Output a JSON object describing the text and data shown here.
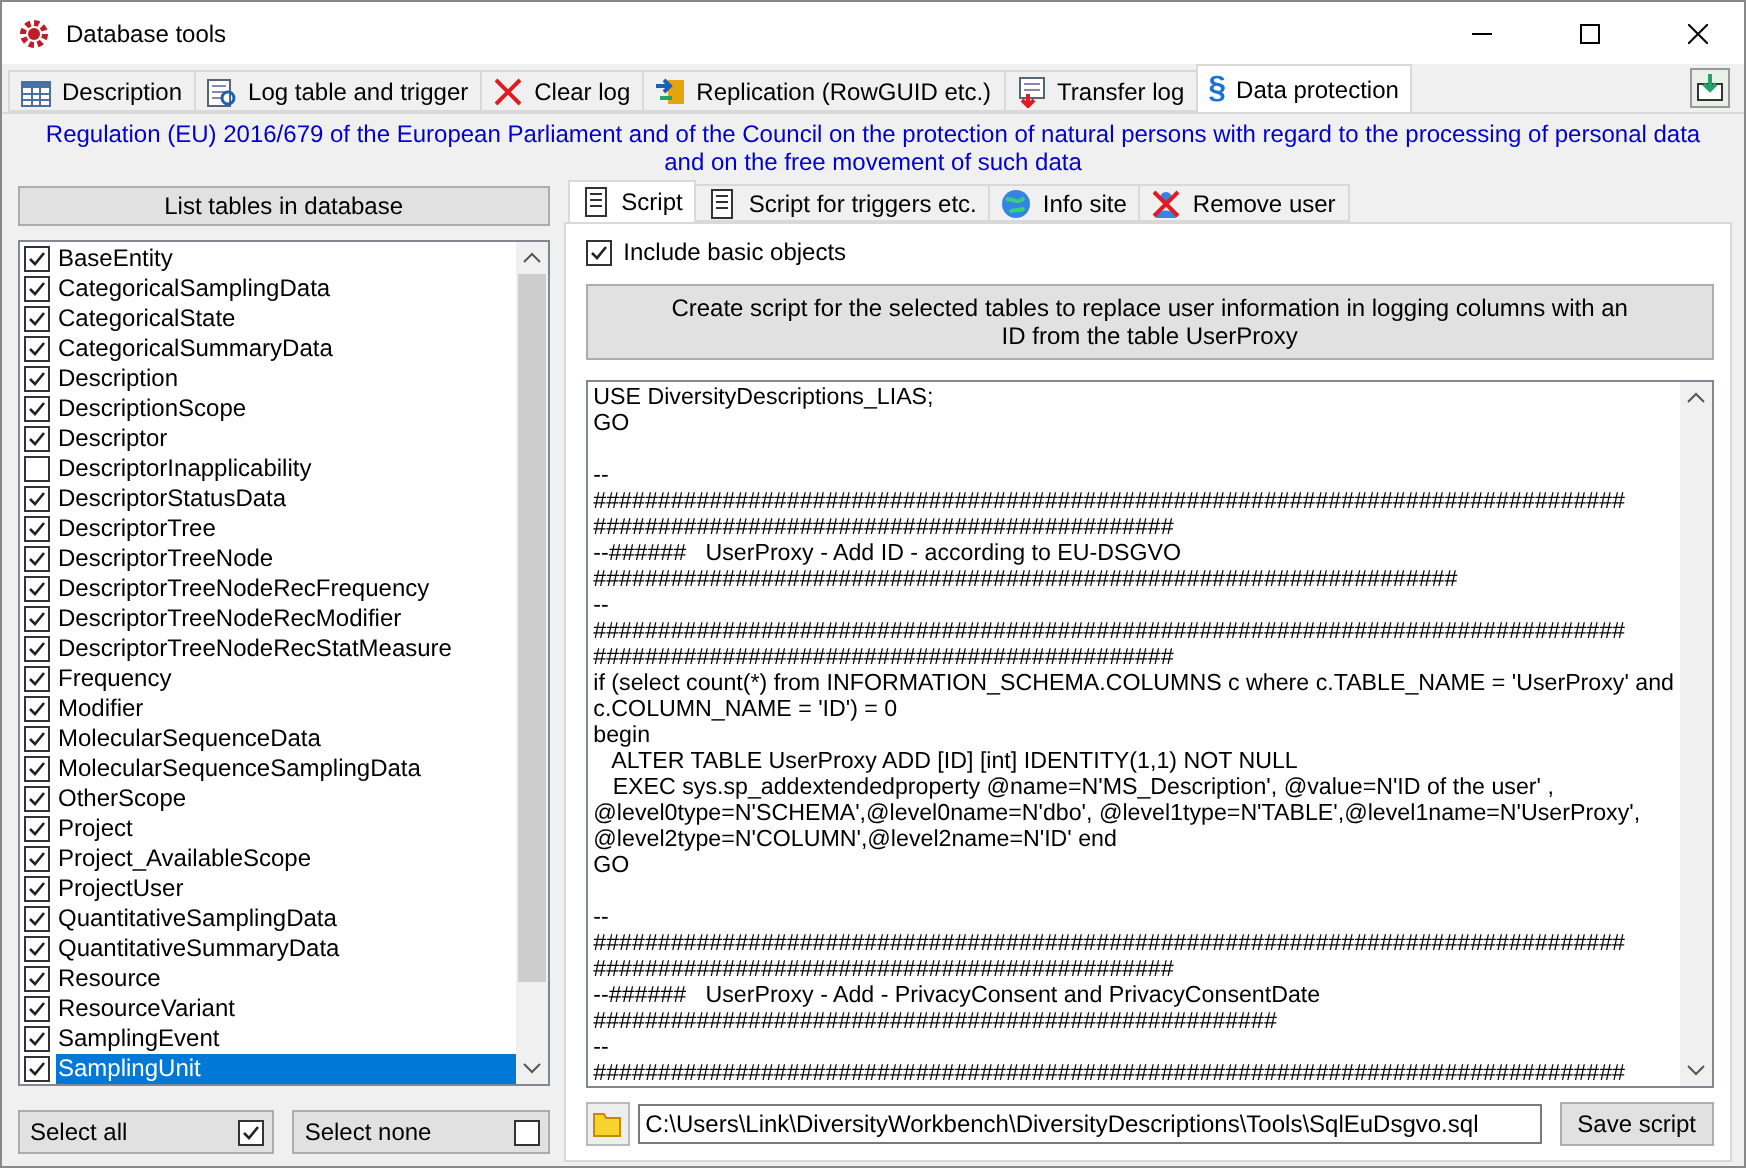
{
  "window": {
    "title": "Database tools"
  },
  "tabs": [
    {
      "label": "Description",
      "selected": false
    },
    {
      "label": "Log table and trigger",
      "selected": false
    },
    {
      "label": "Clear log",
      "selected": false
    },
    {
      "label": "Replication (RowGUID etc.)",
      "selected": false
    },
    {
      "label": "Transfer log",
      "selected": false
    },
    {
      "label": "Data protection",
      "symbol": "§",
      "selected": true
    }
  ],
  "regulation": "Regulation (EU) 2016/679 of the European Parliament and of the Council on the protection of natural persons with regard to the processing of personal data and on the free movement of such data",
  "left_panel": {
    "list_button": "List tables in database",
    "tables": [
      {
        "name": "BaseEntity",
        "checked": true,
        "selected": false
      },
      {
        "name": "CategoricalSamplingData",
        "checked": true,
        "selected": false
      },
      {
        "name": "CategoricalState",
        "checked": true,
        "selected": false
      },
      {
        "name": "CategoricalSummaryData",
        "checked": true,
        "selected": false
      },
      {
        "name": "Description",
        "checked": true,
        "selected": false
      },
      {
        "name": "DescriptionScope",
        "checked": true,
        "selected": false
      },
      {
        "name": "Descriptor",
        "checked": true,
        "selected": false
      },
      {
        "name": "DescriptorInapplicability",
        "checked": false,
        "selected": false
      },
      {
        "name": "DescriptorStatusData",
        "checked": true,
        "selected": false
      },
      {
        "name": "DescriptorTree",
        "checked": true,
        "selected": false
      },
      {
        "name": "DescriptorTreeNode",
        "checked": true,
        "selected": false
      },
      {
        "name": "DescriptorTreeNodeRecFrequency",
        "checked": true,
        "selected": false
      },
      {
        "name": "DescriptorTreeNodeRecModifier",
        "checked": true,
        "selected": false
      },
      {
        "name": "DescriptorTreeNodeRecStatMeasure",
        "checked": true,
        "selected": false
      },
      {
        "name": "Frequency",
        "checked": true,
        "selected": false
      },
      {
        "name": "Modifier",
        "checked": true,
        "selected": false
      },
      {
        "name": "MolecularSequenceData",
        "checked": true,
        "selected": false
      },
      {
        "name": "MolecularSequenceSamplingData",
        "checked": true,
        "selected": false
      },
      {
        "name": "OtherScope",
        "checked": true,
        "selected": false
      },
      {
        "name": "Project",
        "checked": true,
        "selected": false
      },
      {
        "name": "Project_AvailableScope",
        "checked": true,
        "selected": false
      },
      {
        "name": "ProjectUser",
        "checked": true,
        "selected": false
      },
      {
        "name": "QuantitativeSamplingData",
        "checked": true,
        "selected": false
      },
      {
        "name": "QuantitativeSummaryData",
        "checked": true,
        "selected": false
      },
      {
        "name": "Resource",
        "checked": true,
        "selected": false
      },
      {
        "name": "ResourceVariant",
        "checked": true,
        "selected": false
      },
      {
        "name": "SamplingEvent",
        "checked": true,
        "selected": false
      },
      {
        "name": "SamplingUnit",
        "checked": true,
        "selected": true
      }
    ],
    "select_all": {
      "label": "Select all",
      "checked": true
    },
    "select_none": {
      "label": "Select none",
      "checked": false
    }
  },
  "sub_tabs": [
    {
      "label": "Script",
      "selected": true
    },
    {
      "label": "Script for triggers etc.",
      "selected": false
    },
    {
      "label": "Info site",
      "selected": false
    },
    {
      "label": "Remove user",
      "selected": false
    }
  ],
  "script_tab": {
    "include_basic": {
      "label": "Include basic objects",
      "checked": true
    },
    "create_button": "Create script for the selected tables to replace user information in logging columns with an ID from the table UserProxy",
    "script_blocks": [
      [
        "USE DiversityDescriptions_LIAS;",
        "GO"
      ],
      [
        "--",
        "################################################################################",
        "#############################################",
        "--######   UserProxy - Add ID - according to EU-DSGVO",
        "###################################################################",
        "--",
        "################################################################################",
        "#############################################",
        "if (select count(*) from INFORMATION_SCHEMA.COLUMNS c where c.TABLE_NAME = 'UserProxy' and",
        "c.COLUMN_NAME = 'ID') = 0",
        "begin",
        "   ALTER TABLE UserProxy ADD [ID] [int] IDENTITY(1,1) NOT NULL",
        "   EXEC sys.sp_addextendedproperty @name=N'MS_Description', @value=N'ID of the user' ,",
        "@level0type=N'SCHEMA',@level0name=N'dbo', @level1type=N'TABLE',@level1name=N'UserProxy',",
        "@level2type=N'COLUMN',@level2name=N'ID' end",
        "GO"
      ],
      [
        "--",
        "################################################################################",
        "#############################################",
        "--######   UserProxy - Add - PrivacyConsent and PrivacyConsentDate",
        "#####################################################",
        "--",
        "################################################################################"
      ]
    ],
    "file_path": "C:\\Users\\Link\\DiversityWorkbench\\DiversityDescriptions\\Tools\\SqlEuDsgvo.sql",
    "save_button": "Save script"
  }
}
